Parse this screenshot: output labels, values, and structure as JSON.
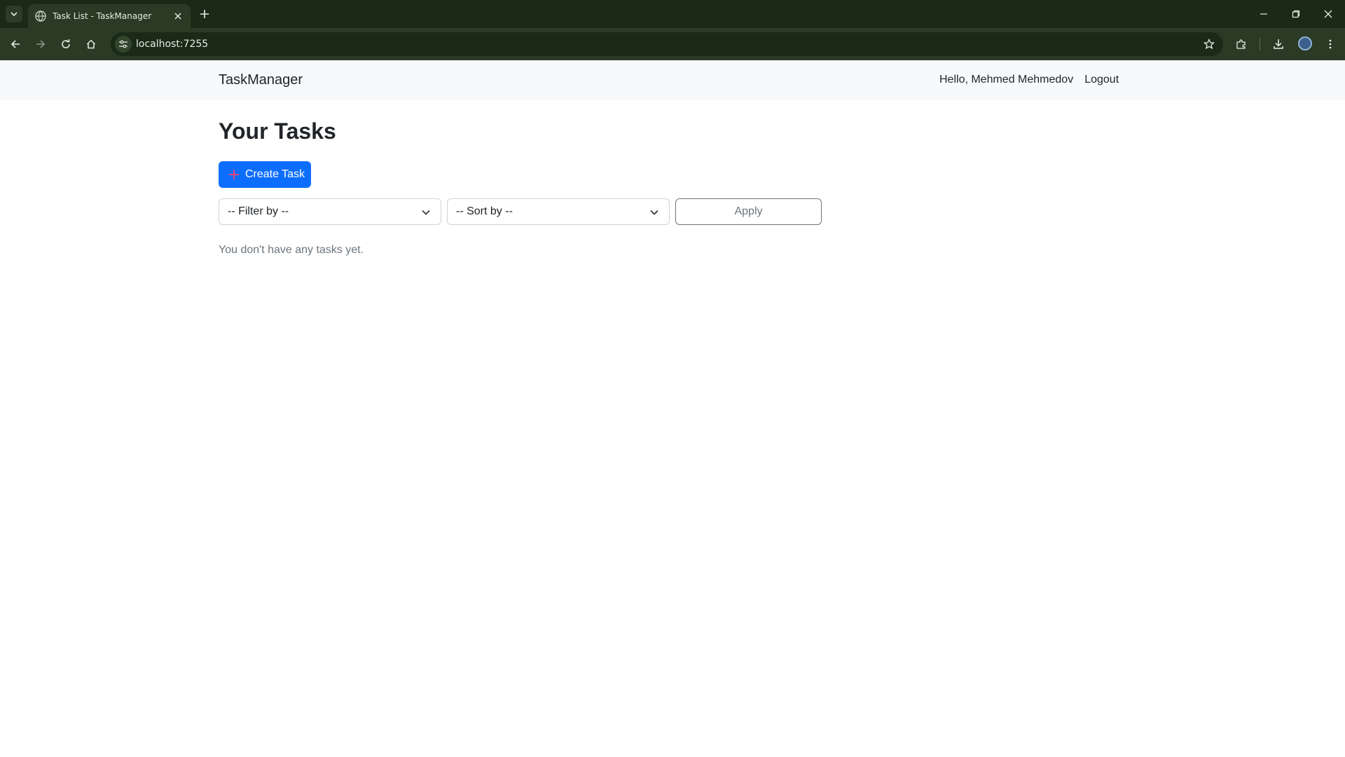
{
  "browser": {
    "tab_title": "Task List - TaskManager",
    "url": "localhost:7255"
  },
  "navbar": {
    "brand": "TaskManager",
    "greeting": "Hello, Mehmed Mehmedov",
    "logout": "Logout"
  },
  "main": {
    "title": "Your Tasks",
    "create_button": "Create Task",
    "filter_placeholder": "-- Filter by --",
    "sort_placeholder": "-- Sort by --",
    "apply_button": "Apply",
    "empty_message": "You don't have any tasks yet."
  },
  "colors": {
    "primary": "#0d6efd",
    "navbar_bg": "#f8f9fa",
    "chrome_bg": "#1b2a17"
  }
}
